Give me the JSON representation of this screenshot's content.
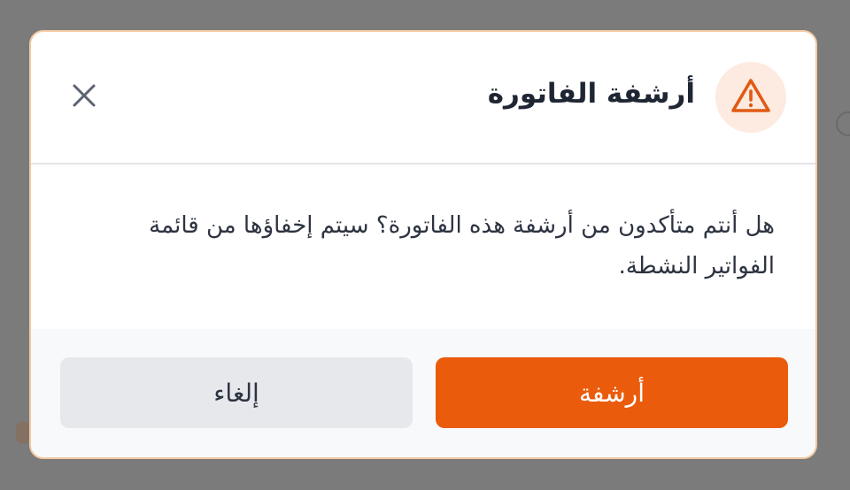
{
  "dialog": {
    "title": "أرشفة الفاتورة",
    "icon": "warning-triangle-icon",
    "message": "هل أنتم متأكدون من أرشفة هذه الفاتورة؟ سيتم إخفاؤها من قائمة الفواتير النشطة.",
    "close_icon": "close-icon",
    "confirm_label": "أرشفة",
    "cancel_label": "إلغاء"
  },
  "colors": {
    "accent": "#ea5b0c",
    "warning_bg": "#fdeae0",
    "dialog_border": "#f3c9a2",
    "overlay": "#7b7b7b"
  }
}
